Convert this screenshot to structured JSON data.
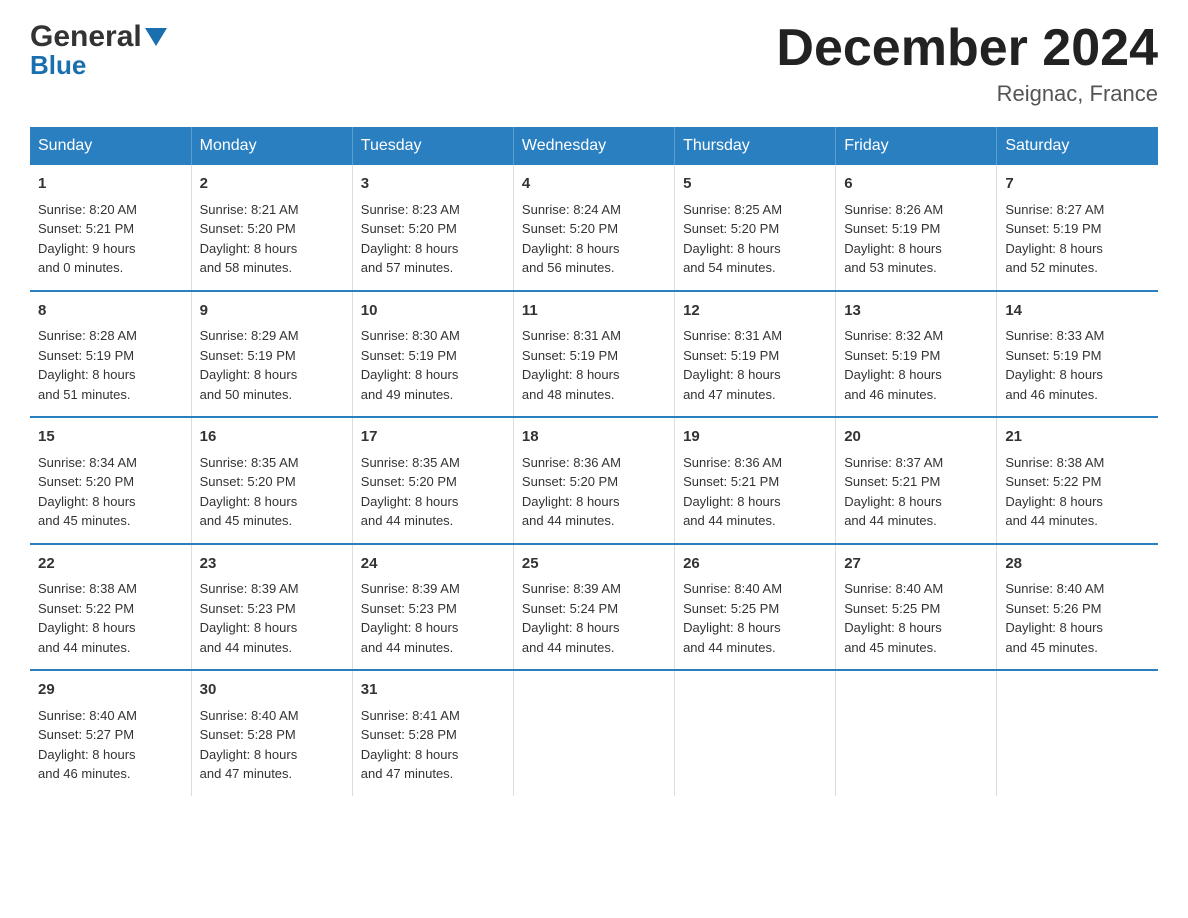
{
  "header": {
    "logo_general": "General",
    "logo_blue": "Blue",
    "month_title": "December 2024",
    "location": "Reignac, France"
  },
  "days_of_week": [
    "Sunday",
    "Monday",
    "Tuesday",
    "Wednesday",
    "Thursday",
    "Friday",
    "Saturday"
  ],
  "weeks": [
    [
      {
        "day": "1",
        "sunrise": "Sunrise: 8:20 AM",
        "sunset": "Sunset: 5:21 PM",
        "daylight": "Daylight: 9 hours",
        "minutes": "and 0 minutes."
      },
      {
        "day": "2",
        "sunrise": "Sunrise: 8:21 AM",
        "sunset": "Sunset: 5:20 PM",
        "daylight": "Daylight: 8 hours",
        "minutes": "and 58 minutes."
      },
      {
        "day": "3",
        "sunrise": "Sunrise: 8:23 AM",
        "sunset": "Sunset: 5:20 PM",
        "daylight": "Daylight: 8 hours",
        "minutes": "and 57 minutes."
      },
      {
        "day": "4",
        "sunrise": "Sunrise: 8:24 AM",
        "sunset": "Sunset: 5:20 PM",
        "daylight": "Daylight: 8 hours",
        "minutes": "and 56 minutes."
      },
      {
        "day": "5",
        "sunrise": "Sunrise: 8:25 AM",
        "sunset": "Sunset: 5:20 PM",
        "daylight": "Daylight: 8 hours",
        "minutes": "and 54 minutes."
      },
      {
        "day": "6",
        "sunrise": "Sunrise: 8:26 AM",
        "sunset": "Sunset: 5:19 PM",
        "daylight": "Daylight: 8 hours",
        "minutes": "and 53 minutes."
      },
      {
        "day": "7",
        "sunrise": "Sunrise: 8:27 AM",
        "sunset": "Sunset: 5:19 PM",
        "daylight": "Daylight: 8 hours",
        "minutes": "and 52 minutes."
      }
    ],
    [
      {
        "day": "8",
        "sunrise": "Sunrise: 8:28 AM",
        "sunset": "Sunset: 5:19 PM",
        "daylight": "Daylight: 8 hours",
        "minutes": "and 51 minutes."
      },
      {
        "day": "9",
        "sunrise": "Sunrise: 8:29 AM",
        "sunset": "Sunset: 5:19 PM",
        "daylight": "Daylight: 8 hours",
        "minutes": "and 50 minutes."
      },
      {
        "day": "10",
        "sunrise": "Sunrise: 8:30 AM",
        "sunset": "Sunset: 5:19 PM",
        "daylight": "Daylight: 8 hours",
        "minutes": "and 49 minutes."
      },
      {
        "day": "11",
        "sunrise": "Sunrise: 8:31 AM",
        "sunset": "Sunset: 5:19 PM",
        "daylight": "Daylight: 8 hours",
        "minutes": "and 48 minutes."
      },
      {
        "day": "12",
        "sunrise": "Sunrise: 8:31 AM",
        "sunset": "Sunset: 5:19 PM",
        "daylight": "Daylight: 8 hours",
        "minutes": "and 47 minutes."
      },
      {
        "day": "13",
        "sunrise": "Sunrise: 8:32 AM",
        "sunset": "Sunset: 5:19 PM",
        "daylight": "Daylight: 8 hours",
        "minutes": "and 46 minutes."
      },
      {
        "day": "14",
        "sunrise": "Sunrise: 8:33 AM",
        "sunset": "Sunset: 5:19 PM",
        "daylight": "Daylight: 8 hours",
        "minutes": "and 46 minutes."
      }
    ],
    [
      {
        "day": "15",
        "sunrise": "Sunrise: 8:34 AM",
        "sunset": "Sunset: 5:20 PM",
        "daylight": "Daylight: 8 hours",
        "minutes": "and 45 minutes."
      },
      {
        "day": "16",
        "sunrise": "Sunrise: 8:35 AM",
        "sunset": "Sunset: 5:20 PM",
        "daylight": "Daylight: 8 hours",
        "minutes": "and 45 minutes."
      },
      {
        "day": "17",
        "sunrise": "Sunrise: 8:35 AM",
        "sunset": "Sunset: 5:20 PM",
        "daylight": "Daylight: 8 hours",
        "minutes": "and 44 minutes."
      },
      {
        "day": "18",
        "sunrise": "Sunrise: 8:36 AM",
        "sunset": "Sunset: 5:20 PM",
        "daylight": "Daylight: 8 hours",
        "minutes": "and 44 minutes."
      },
      {
        "day": "19",
        "sunrise": "Sunrise: 8:36 AM",
        "sunset": "Sunset: 5:21 PM",
        "daylight": "Daylight: 8 hours",
        "minutes": "and 44 minutes."
      },
      {
        "day": "20",
        "sunrise": "Sunrise: 8:37 AM",
        "sunset": "Sunset: 5:21 PM",
        "daylight": "Daylight: 8 hours",
        "minutes": "and 44 minutes."
      },
      {
        "day": "21",
        "sunrise": "Sunrise: 8:38 AM",
        "sunset": "Sunset: 5:22 PM",
        "daylight": "Daylight: 8 hours",
        "minutes": "and 44 minutes."
      }
    ],
    [
      {
        "day": "22",
        "sunrise": "Sunrise: 8:38 AM",
        "sunset": "Sunset: 5:22 PM",
        "daylight": "Daylight: 8 hours",
        "minutes": "and 44 minutes."
      },
      {
        "day": "23",
        "sunrise": "Sunrise: 8:39 AM",
        "sunset": "Sunset: 5:23 PM",
        "daylight": "Daylight: 8 hours",
        "minutes": "and 44 minutes."
      },
      {
        "day": "24",
        "sunrise": "Sunrise: 8:39 AM",
        "sunset": "Sunset: 5:23 PM",
        "daylight": "Daylight: 8 hours",
        "minutes": "and 44 minutes."
      },
      {
        "day": "25",
        "sunrise": "Sunrise: 8:39 AM",
        "sunset": "Sunset: 5:24 PM",
        "daylight": "Daylight: 8 hours",
        "minutes": "and 44 minutes."
      },
      {
        "day": "26",
        "sunrise": "Sunrise: 8:40 AM",
        "sunset": "Sunset: 5:25 PM",
        "daylight": "Daylight: 8 hours",
        "minutes": "and 44 minutes."
      },
      {
        "day": "27",
        "sunrise": "Sunrise: 8:40 AM",
        "sunset": "Sunset: 5:25 PM",
        "daylight": "Daylight: 8 hours",
        "minutes": "and 45 minutes."
      },
      {
        "day": "28",
        "sunrise": "Sunrise: 8:40 AM",
        "sunset": "Sunset: 5:26 PM",
        "daylight": "Daylight: 8 hours",
        "minutes": "and 45 minutes."
      }
    ],
    [
      {
        "day": "29",
        "sunrise": "Sunrise: 8:40 AM",
        "sunset": "Sunset: 5:27 PM",
        "daylight": "Daylight: 8 hours",
        "minutes": "and 46 minutes."
      },
      {
        "day": "30",
        "sunrise": "Sunrise: 8:40 AM",
        "sunset": "Sunset: 5:28 PM",
        "daylight": "Daylight: 8 hours",
        "minutes": "and 47 minutes."
      },
      {
        "day": "31",
        "sunrise": "Sunrise: 8:41 AM",
        "sunset": "Sunset: 5:28 PM",
        "daylight": "Daylight: 8 hours",
        "minutes": "and 47 minutes."
      },
      {
        "day": "",
        "sunrise": "",
        "sunset": "",
        "daylight": "",
        "minutes": ""
      },
      {
        "day": "",
        "sunrise": "",
        "sunset": "",
        "daylight": "",
        "minutes": ""
      },
      {
        "day": "",
        "sunrise": "",
        "sunset": "",
        "daylight": "",
        "minutes": ""
      },
      {
        "day": "",
        "sunrise": "",
        "sunset": "",
        "daylight": "",
        "minutes": ""
      }
    ]
  ]
}
